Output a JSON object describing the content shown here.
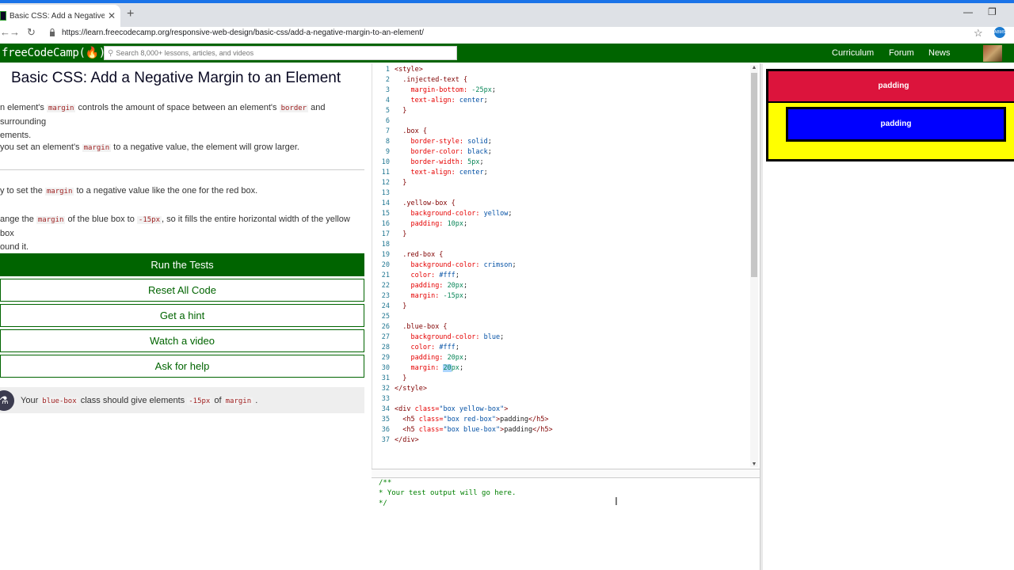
{
  "browser": {
    "tab_title": "Basic CSS: Add a Negative Margin",
    "tab_close": "✕",
    "new_tab": "+",
    "minimize": "—",
    "restore": "❐",
    "back": "←",
    "forward": "→",
    "reload": "↻",
    "url": "https://learn.freecodecamp.org/responsive-web-design/basic-css/add-a-negative-margin-to-an-element/",
    "star": "☆",
    "extension_label": "ABMS"
  },
  "navbar": {
    "logo": "freeCodeCamp(🔥)",
    "search_placeholder": "Search 8,000+ lessons, articles, and videos",
    "links": [
      "Curriculum",
      "Forum",
      "News"
    ]
  },
  "lesson": {
    "title": "Basic CSS: Add a Negative Margin to an Element",
    "p1_a": "n element's ",
    "p1_code1": "margin",
    "p1_b": " controls the amount of space between an element's ",
    "p1_code2": "border",
    "p1_c": " and surrounding",
    "p1_d": "ements.",
    "p2_a": "you set an element's ",
    "p2_code": "margin",
    "p2_b": " to a negative value, the element will grow larger.",
    "p3_a": "y to set the ",
    "p3_code": "margin",
    "p3_b": " to a negative value like the one for the red box.",
    "p4_a": "ange the ",
    "p4_code1": "margin",
    "p4_b": " of the blue box to ",
    "p4_code2": "-15px",
    "p4_c": ", so it fills the entire horizontal width of the yellow box",
    "p4_d": "ound it.",
    "buttons": {
      "run": "Run the Tests",
      "reset": "Reset All Code",
      "hint": "Get a hint",
      "video": "Watch a video",
      "help": "Ask for help"
    },
    "test": {
      "a": "Your ",
      "code1": "blue-box",
      "b": " class should give elements ",
      "code2": "-15px",
      "c": " of ",
      "code3": "margin",
      "d": " ."
    }
  },
  "output": {
    "text": "/**\n* Your test output will go here.\n*/"
  },
  "preview": {
    "red_text": "padding",
    "blue_text": "padding",
    "colors": {
      "yellow": "#ffff00",
      "red": "#dc143c",
      "blue": "#0000ff"
    }
  },
  "icons": {
    "search": "search-icon",
    "flask": "flask-icon",
    "lock": "lock-icon",
    "star": "star-icon"
  }
}
